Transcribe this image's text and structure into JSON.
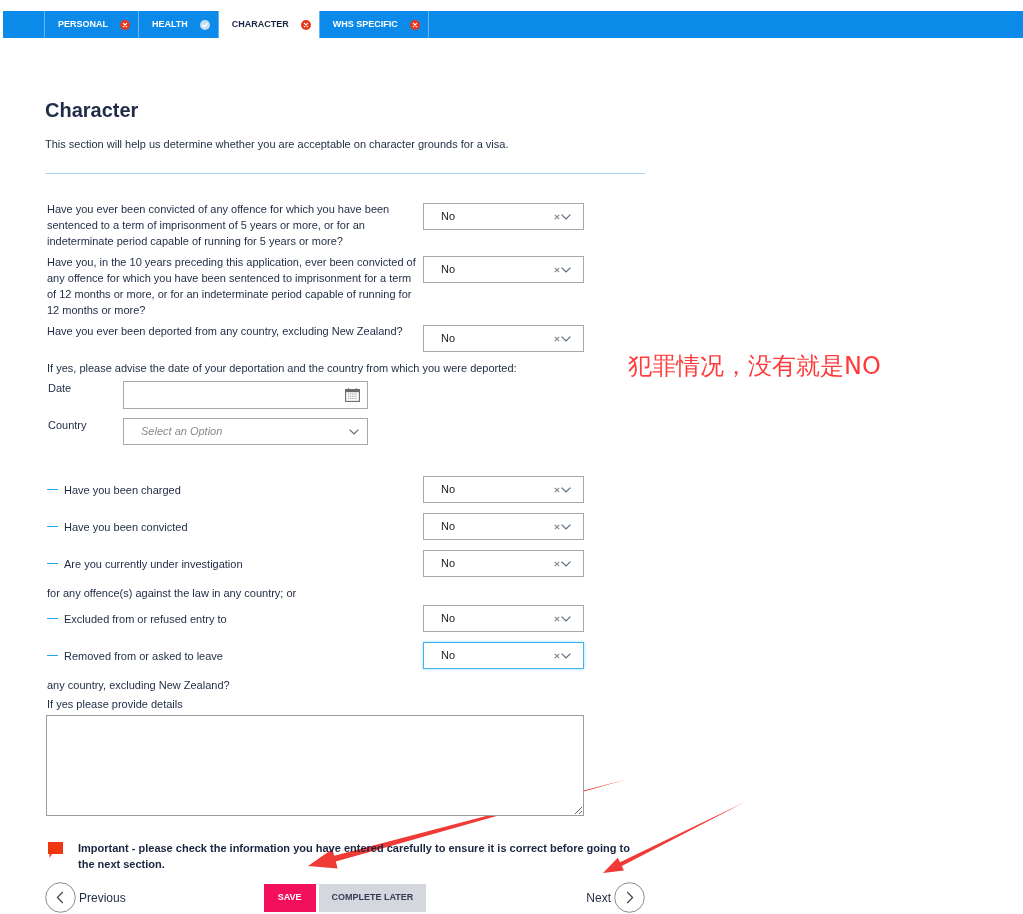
{
  "tabs": [
    {
      "label": "PERSONAL",
      "complete": false,
      "selected": false
    },
    {
      "label": "HEALTH",
      "complete": true,
      "selected": false
    },
    {
      "label": "CHARACTER",
      "complete": false,
      "selected": true
    },
    {
      "label": "WHS SPECIFIC",
      "complete": false,
      "selected": false
    }
  ],
  "section": {
    "title": "Character",
    "description": "This section will help us determine whether you are acceptable on character grounds for a visa."
  },
  "items": [
    {
      "kind": "question",
      "label": "Have you ever been convicted of any offence for which you have been sentenced to a term of imprisonment of 5 years or more, or for an indeterminate period capable of running for 5 years or more?",
      "value": "No",
      "focused": false
    },
    {
      "kind": "question",
      "label": "Have you, in the 10 years preceding this application, ever been convicted of any offence for which you have been sentenced to imprisonment for a term of 12 months or more, or for an indeterminate period capable of running for 12 months or more?",
      "value": "No",
      "focused": false
    },
    {
      "kind": "question",
      "label": "Have you ever been deported from any country, excluding New Zealand?",
      "value": "No",
      "focused": false
    },
    {
      "kind": "text",
      "text": "If yes, please advise the date of your deportation and the country from which you were deported:"
    },
    {
      "kind": "date",
      "label": "Date"
    },
    {
      "kind": "select",
      "label": "Country",
      "placeholder": "Select an Option"
    },
    {
      "kind": "sub_question",
      "label": "Have you been charged",
      "value": "No",
      "focused": false
    },
    {
      "kind": "sub_question",
      "label": "Have you been convicted",
      "value": "No",
      "focused": false
    },
    {
      "kind": "sub_question",
      "label": "Are you currently under investigation",
      "value": "No",
      "focused": false
    },
    {
      "kind": "text",
      "text": "for any offence(s) against the law in any country; or"
    },
    {
      "kind": "sub_question",
      "label": "Excluded from or refused entry to",
      "value": "No",
      "focused": false
    },
    {
      "kind": "sub_question",
      "label": "Removed from or asked to leave",
      "value": "No",
      "focused": true
    },
    {
      "kind": "text",
      "text": "any country, excluding New Zealand?"
    },
    {
      "kind": "textarea",
      "label": "If yes please provide details"
    }
  ],
  "notice": "Important - please check the information you have entered carefully to ensure it is correct before going to the next section.",
  "footer": {
    "previous": "Previous",
    "save": "SAVE",
    "complete_later": "COMPLETE LATER",
    "next": "Next"
  },
  "annotation": "犯罪情况，没有就是NO"
}
